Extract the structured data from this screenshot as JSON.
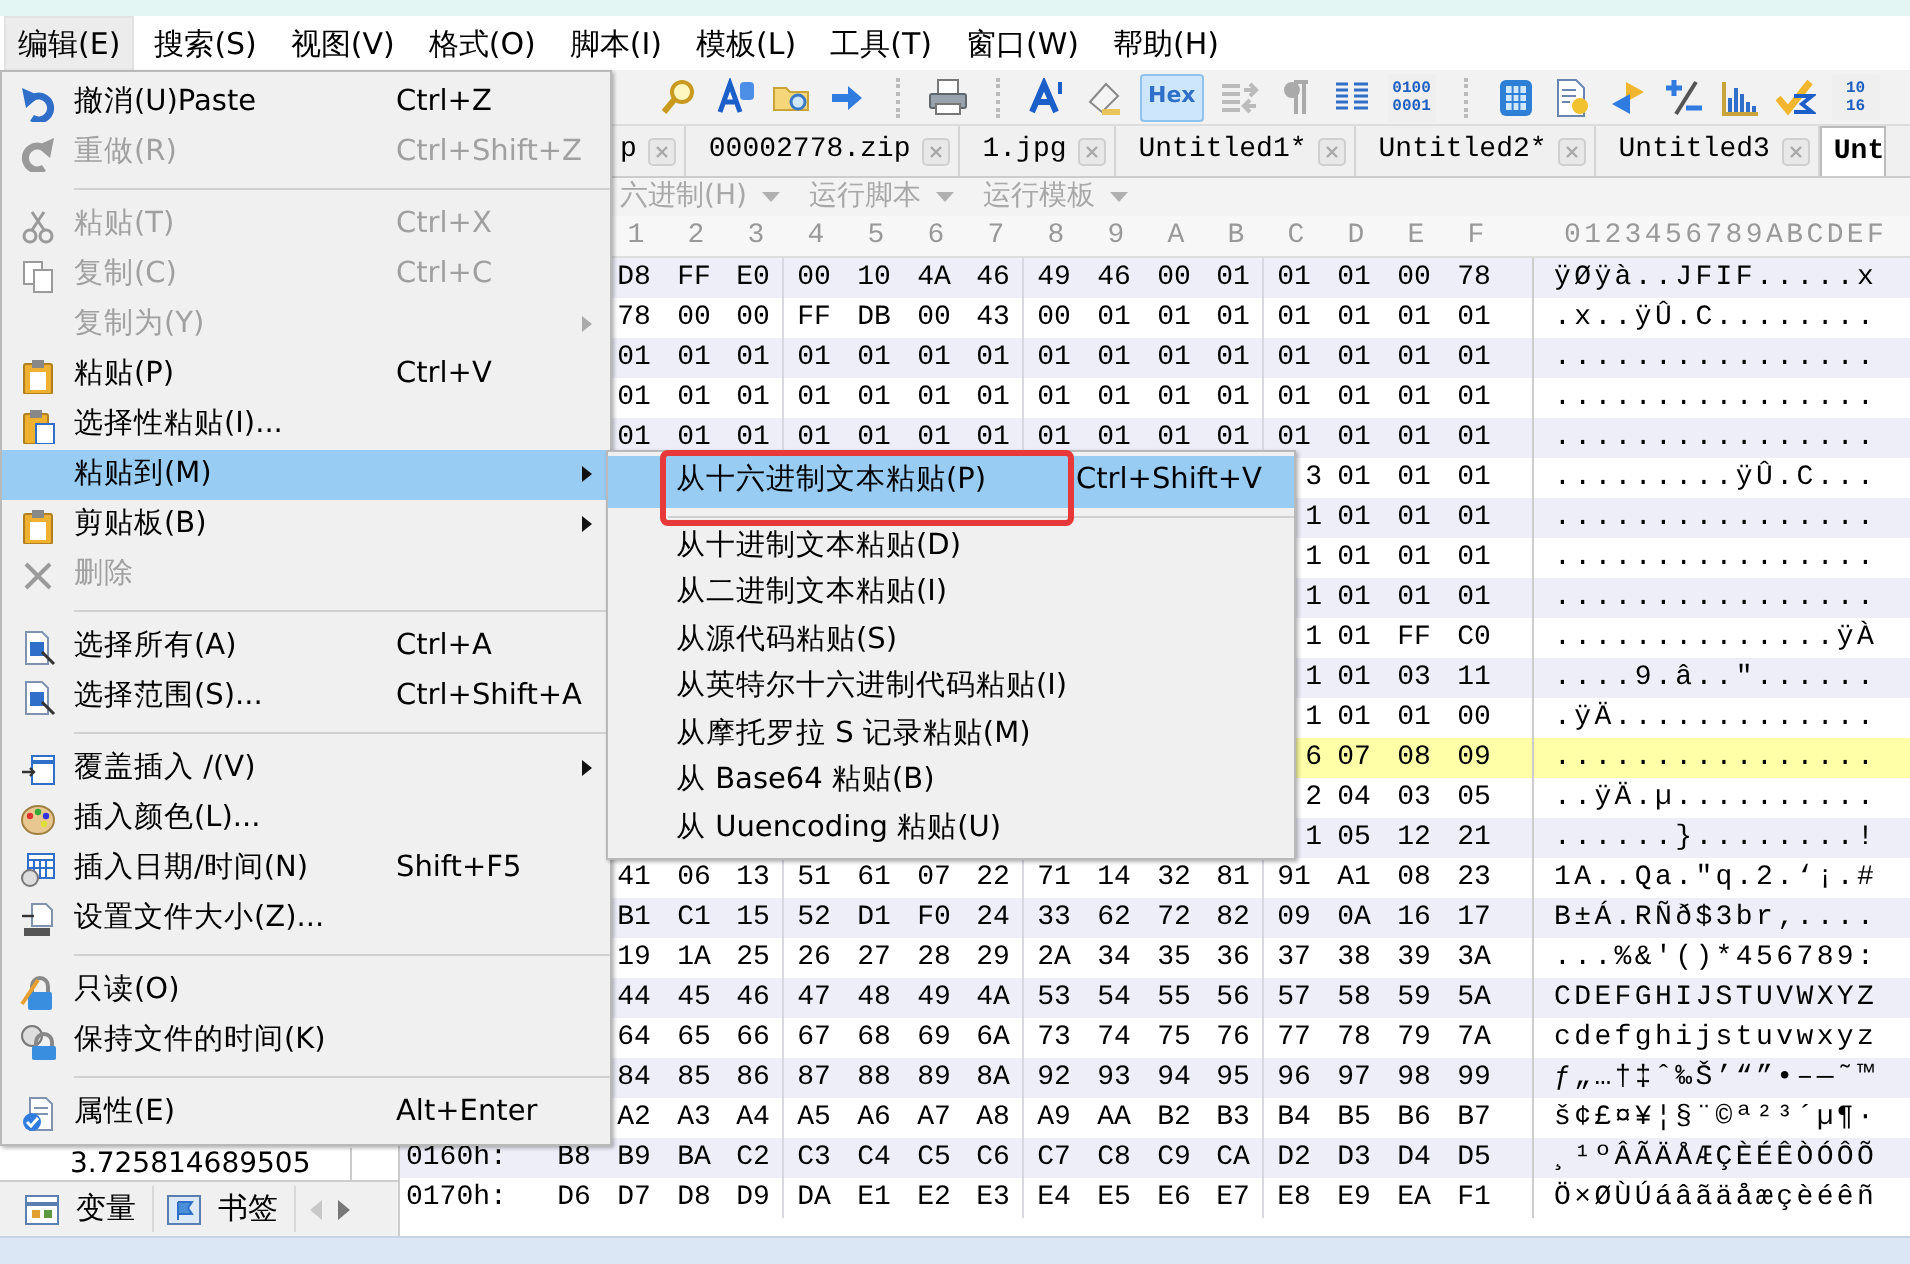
{
  "menubar": [
    {
      "label": "编辑(E)",
      "selected": true
    },
    {
      "label": "搜索(S)",
      "selected": false
    },
    {
      "label": "视图(V)",
      "selected": false
    },
    {
      "label": "格式(O)",
      "selected": false
    },
    {
      "label": "脚本(I)",
      "selected": false
    },
    {
      "label": "模板(L)",
      "selected": false
    },
    {
      "label": "工具(T)",
      "selected": false
    },
    {
      "label": "窗口(W)",
      "selected": false
    },
    {
      "label": "帮助(H)",
      "selected": false
    }
  ],
  "toolbar": {
    "hex_button": {
      "label": "Hex",
      "selected": true
    },
    "binary_button": {
      "label": "0100 0001"
    },
    "base_button": {
      "label": "10 16"
    }
  },
  "tabs": [
    {
      "label": "p",
      "selected": false
    },
    {
      "label": "00002778.zip",
      "selected": false
    },
    {
      "label": "1.jpg",
      "selected": false
    },
    {
      "label": "Untitled1*",
      "selected": false
    },
    {
      "label": "Untitled2*",
      "selected": false
    },
    {
      "label": "Untitled3",
      "selected": false
    },
    {
      "label": "Unt",
      "selected": true
    }
  ],
  "script_bar": [
    "六进制(H)",
    "运行脚本",
    "运行模板"
  ],
  "hex_header": {
    "columns": [
      "1",
      "2",
      "3",
      "4",
      "5",
      "6",
      "7",
      "8",
      "9",
      "A",
      "B",
      "C",
      "D",
      "E",
      "F"
    ],
    "ascii": "0123456789ABCDEF"
  },
  "hex_rows": [
    {
      "cells": [
        "D8",
        "FF",
        "E0",
        "00",
        "10",
        "4A",
        "46",
        "49",
        "46",
        "00",
        "01",
        "01",
        "01",
        "00",
        "78"
      ],
      "ascii": "ÿØÿà..JFIF.....x",
      "highlighted": false
    },
    {
      "cells": [
        "78",
        "00",
        "00",
        "FF",
        "DB",
        "00",
        "43",
        "00",
        "01",
        "01",
        "01",
        "01",
        "01",
        "01",
        "01"
      ],
      "ascii": ".x..ÿÛ.C........",
      "highlighted": false
    },
    {
      "cells": [
        "01",
        "01",
        "01",
        "01",
        "01",
        "01",
        "01",
        "01",
        "01",
        "01",
        "01",
        "01",
        "01",
        "01",
        "01"
      ],
      "ascii": "................",
      "highlighted": false
    },
    {
      "cells": [
        "01",
        "01",
        "01",
        "01",
        "01",
        "01",
        "01",
        "01",
        "01",
        "01",
        "01",
        "01",
        "01",
        "01",
        "01"
      ],
      "ascii": "................",
      "highlighted": false
    },
    {
      "cells": [
        "01",
        "01",
        "01",
        "01",
        "01",
        "01",
        "01",
        "01",
        "01",
        "01",
        "01",
        "01",
        "01",
        "01",
        "01"
      ],
      "ascii": "................",
      "highlighted": false
    },
    {
      "cells": [
        "3",
        "01",
        "01",
        "01"
      ],
      "ascii": ".........ÿÛ.C...",
      "highlighted": false
    },
    {
      "cells": [
        "1",
        "01",
        "01",
        "01"
      ],
      "ascii": "................",
      "highlighted": false
    },
    {
      "cells": [
        "1",
        "01",
        "01",
        "01"
      ],
      "ascii": "................",
      "highlighted": false
    },
    {
      "cells": [
        "1",
        "01",
        "01",
        "01"
      ],
      "ascii": "................",
      "highlighted": false
    },
    {
      "cells": [
        "1",
        "01",
        "FF",
        "C0"
      ],
      "ascii": "..............ÿÀ",
      "highlighted": false
    },
    {
      "cells": [
        "1",
        "01",
        "03",
        "11"
      ],
      "ascii": "....9.â..\"......",
      "highlighted": false
    },
    {
      "cells": [
        "1",
        "01",
        "01",
        "00"
      ],
      "ascii": ".ÿÄ.............",
      "highlighted": false
    },
    {
      "cells": [
        "6",
        "07",
        "08",
        "09"
      ],
      "ascii": "................",
      "highlighted": true
    },
    {
      "cells": [
        "2",
        "04",
        "03",
        "05"
      ],
      "ascii": "..ÿÄ.µ..........",
      "highlighted": false
    },
    {
      "cells": [
        "1",
        "05",
        "12",
        "21"
      ],
      "ascii": "......}........!",
      "highlighted": false
    },
    {
      "cells": [
        "41",
        "06",
        "13",
        "51",
        "61",
        "07",
        "22",
        "71",
        "14",
        "32",
        "81",
        "91",
        "A1",
        "08",
        "23"
      ],
      "ascii": "1A..Qa.\"q.2.‘¡.#",
      "highlighted": false
    },
    {
      "cells": [
        "B1",
        "C1",
        "15",
        "52",
        "D1",
        "F0",
        "24",
        "33",
        "62",
        "72",
        "82",
        "09",
        "0A",
        "16",
        "17"
      ],
      "ascii": "B±Á.RÑð$3br‚....",
      "highlighted": false
    },
    {
      "cells": [
        "19",
        "1A",
        "25",
        "26",
        "27",
        "28",
        "29",
        "2A",
        "34",
        "35",
        "36",
        "37",
        "38",
        "39",
        "3A"
      ],
      "ascii": "...%&'()*456789:",
      "highlighted": false
    },
    {
      "cells": [
        "44",
        "45",
        "46",
        "47",
        "48",
        "49",
        "4A",
        "53",
        "54",
        "55",
        "56",
        "57",
        "58",
        "59",
        "5A"
      ],
      "ascii": "CDEFGHIJSTUVWXYZ",
      "highlighted": false
    },
    {
      "cells": [
        "64",
        "65",
        "66",
        "67",
        "68",
        "69",
        "6A",
        "73",
        "74",
        "75",
        "76",
        "77",
        "78",
        "79",
        "7A"
      ],
      "ascii": "cdefghijstuvwxyz",
      "highlighted": false
    },
    {
      "cells": [
        "84",
        "85",
        "86",
        "87",
        "88",
        "89",
        "8A",
        "92",
        "93",
        "94",
        "95",
        "96",
        "97",
        "98",
        "99"
      ],
      "ascii": "ƒ„…†‡ˆ‰Š’“”•–—˜™",
      "highlighted": false
    },
    {
      "cells": [
        "A2",
        "A3",
        "A4",
        "A5",
        "A6",
        "A7",
        "A8",
        "A9",
        "AA",
        "B2",
        "B3",
        "B4",
        "B5",
        "B6",
        "B7"
      ],
      "ascii": "š¢£¤¥¦§¨©ª²³´µ¶·",
      "highlighted": false
    },
    {
      "offset": "0160h:",
      "cells": [
        "B8",
        "B9",
        "BA",
        "C2",
        "C3",
        "C4",
        "C5",
        "C6",
        "C7",
        "C8",
        "C9",
        "CA",
        "D2",
        "D3",
        "D4",
        "D5"
      ],
      "ascii": "¸¹ºÂÃÄÅÆÇÈÉÊÒÓÔÕ",
      "highlighted": false
    },
    {
      "offset": "0170h:",
      "cells": [
        "D6",
        "D7",
        "D8",
        "D9",
        "DA",
        "E1",
        "E2",
        "E3",
        "E4",
        "E5",
        "E6",
        "E7",
        "E8",
        "E9",
        "EA",
        "F1"
      ],
      "ascii": "Ö×ØÙÚáâãäåæçèéêñ",
      "highlighted": false
    }
  ],
  "variables_panel": {
    "values": [
      "3.725814689505"
    ],
    "tabs": [
      "变量",
      "书签"
    ]
  },
  "edit_menu": {
    "items": [
      {
        "kind": "item",
        "label": "撤消(U)Paste",
        "shortcut": "Ctrl+Z",
        "disabled": false,
        "has_submenu": false,
        "selected": false
      },
      {
        "kind": "item",
        "label": "重做(R)",
        "shortcut": "Ctrl+Shift+Z",
        "disabled": true,
        "has_submenu": false,
        "selected": false
      },
      {
        "kind": "separator"
      },
      {
        "kind": "item",
        "label": "粘贴(T)",
        "shortcut": "Ctrl+X",
        "disabled": true,
        "has_submenu": false,
        "selected": false
      },
      {
        "kind": "item",
        "label": "复制(C)",
        "shortcut": "Ctrl+C",
        "disabled": true,
        "has_submenu": false,
        "selected": false
      },
      {
        "kind": "item",
        "label": "复制为(Y)",
        "disabled": true,
        "has_submenu": true,
        "selected": false
      },
      {
        "kind": "item",
        "label": "粘贴(P)",
        "shortcut": "Ctrl+V",
        "disabled": false,
        "has_submenu": false,
        "selected": false
      },
      {
        "kind": "item",
        "label": "选择性粘贴(I)...",
        "disabled": false,
        "has_submenu": false,
        "selected": false
      },
      {
        "kind": "item",
        "label": "粘贴到(M)",
        "disabled": false,
        "has_submenu": true,
        "selected": true
      },
      {
        "kind": "item",
        "label": "剪贴板(B)",
        "disabled": false,
        "has_submenu": true,
        "selected": false
      },
      {
        "kind": "item",
        "label": "删除",
        "disabled": true,
        "has_submenu": false,
        "selected": false
      },
      {
        "kind": "separator"
      },
      {
        "kind": "item",
        "label": "选择所有(A)",
        "shortcut": "Ctrl+A",
        "disabled": false,
        "has_submenu": false,
        "selected": false
      },
      {
        "kind": "item",
        "label": "选择范围(S)...",
        "shortcut": "Ctrl+Shift+A",
        "disabled": false,
        "has_submenu": false,
        "selected": false
      },
      {
        "kind": "separator"
      },
      {
        "kind": "item",
        "label": "覆盖插入 /(V)",
        "disabled": false,
        "has_submenu": true,
        "selected": false
      },
      {
        "kind": "item",
        "label": "插入颜色(L)...",
        "disabled": false,
        "has_submenu": false,
        "selected": false
      },
      {
        "kind": "item",
        "label": "插入日期/时间(N)",
        "shortcut": "Shift+F5",
        "disabled": false,
        "has_submenu": false,
        "selected": false
      },
      {
        "kind": "item",
        "label": "设置文件大小(Z)...",
        "disabled": false,
        "has_submenu": false,
        "selected": false
      },
      {
        "kind": "separator"
      },
      {
        "kind": "item",
        "label": "只读(O)",
        "disabled": false,
        "has_submenu": false,
        "selected": false
      },
      {
        "kind": "item",
        "label": "保持文件的时间(K)",
        "disabled": false,
        "has_submenu": false,
        "selected": false
      },
      {
        "kind": "separator"
      },
      {
        "kind": "item",
        "label": "属性(E)",
        "shortcut": "Alt+Enter",
        "disabled": false,
        "has_submenu": false,
        "selected": false
      }
    ]
  },
  "paste_to_submenu": {
    "items": [
      {
        "kind": "item",
        "label": "从十六进制文本粘贴(P)",
        "shortcut": "Ctrl+Shift+V",
        "selected": true,
        "marked": true
      },
      {
        "kind": "separator"
      },
      {
        "kind": "item",
        "label": "从十进制文本粘贴(D)",
        "selected": false,
        "marked": false
      },
      {
        "kind": "item",
        "label": "从二进制文本粘贴(I)",
        "selected": false,
        "marked": false
      },
      {
        "kind": "item",
        "label": "从源代码粘贴(S)",
        "selected": false,
        "marked": false
      },
      {
        "kind": "item",
        "label": "从英特尔十六进制代码粘贴(I)",
        "selected": false,
        "marked": false
      },
      {
        "kind": "item",
        "label": "从摩托罗拉 S 记录粘贴(M)",
        "selected": false,
        "marked": false
      },
      {
        "kind": "item",
        "label": "从 Base64 粘贴(B)",
        "selected": false,
        "marked": false
      },
      {
        "kind": "item",
        "label": "从 Uuencoding 粘贴(U)",
        "selected": false,
        "marked": false
      }
    ]
  }
}
